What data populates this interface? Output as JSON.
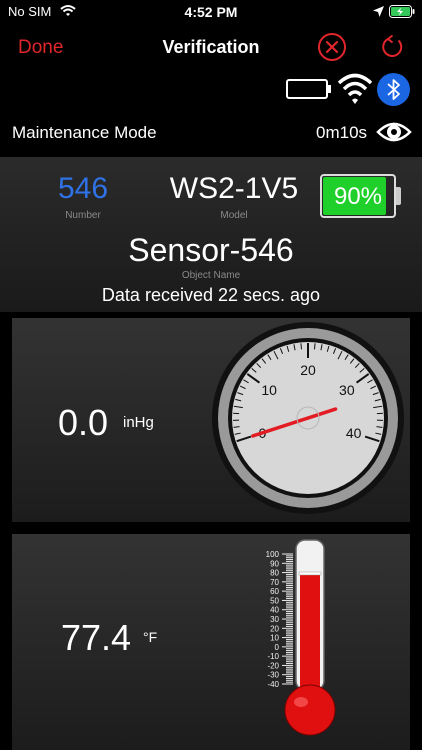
{
  "status_bar": {
    "carrier": "No SIM",
    "time": "4:52 PM",
    "battery_level": 1.0
  },
  "nav": {
    "done_label": "Done",
    "title": "Verification"
  },
  "maintenance": {
    "label": "Maintenance Mode",
    "timer": "0m10s"
  },
  "device": {
    "number": "546",
    "number_caption": "Number",
    "model": "WS2-1V5",
    "model_caption": "Model",
    "battery_percent": 90,
    "battery_label": "90%",
    "object_name": "Sensor-546",
    "object_caption": "Object Name",
    "data_received": "Data received 22 secs. ago"
  },
  "pressure": {
    "value": "0.0",
    "unit": "inHg",
    "gauge_ticks": [
      "0",
      "10",
      "20",
      "30",
      "40"
    ],
    "gauge_reading": 0.0
  },
  "temperature": {
    "value": "77.4",
    "unit": "°F",
    "scale_labels": [
      "100",
      "90",
      "80",
      "70",
      "60",
      "50",
      "40",
      "30",
      "20",
      "10",
      "0",
      "-10",
      "-20",
      "-30",
      "-40"
    ],
    "reading": 77.4
  },
  "colors": {
    "accent_red": "#e0262b",
    "number_blue": "#2f72e6",
    "bluetooth_blue": "#1b67e3",
    "battery_green": "#1fcf2a",
    "mercury_red": "#e01010"
  },
  "icons": [
    "wifi-icon",
    "location-arrow-icon",
    "battery-charging-icon",
    "close-icon",
    "refresh-icon",
    "device-battery-icon",
    "bluetooth-icon",
    "eye-icon"
  ]
}
